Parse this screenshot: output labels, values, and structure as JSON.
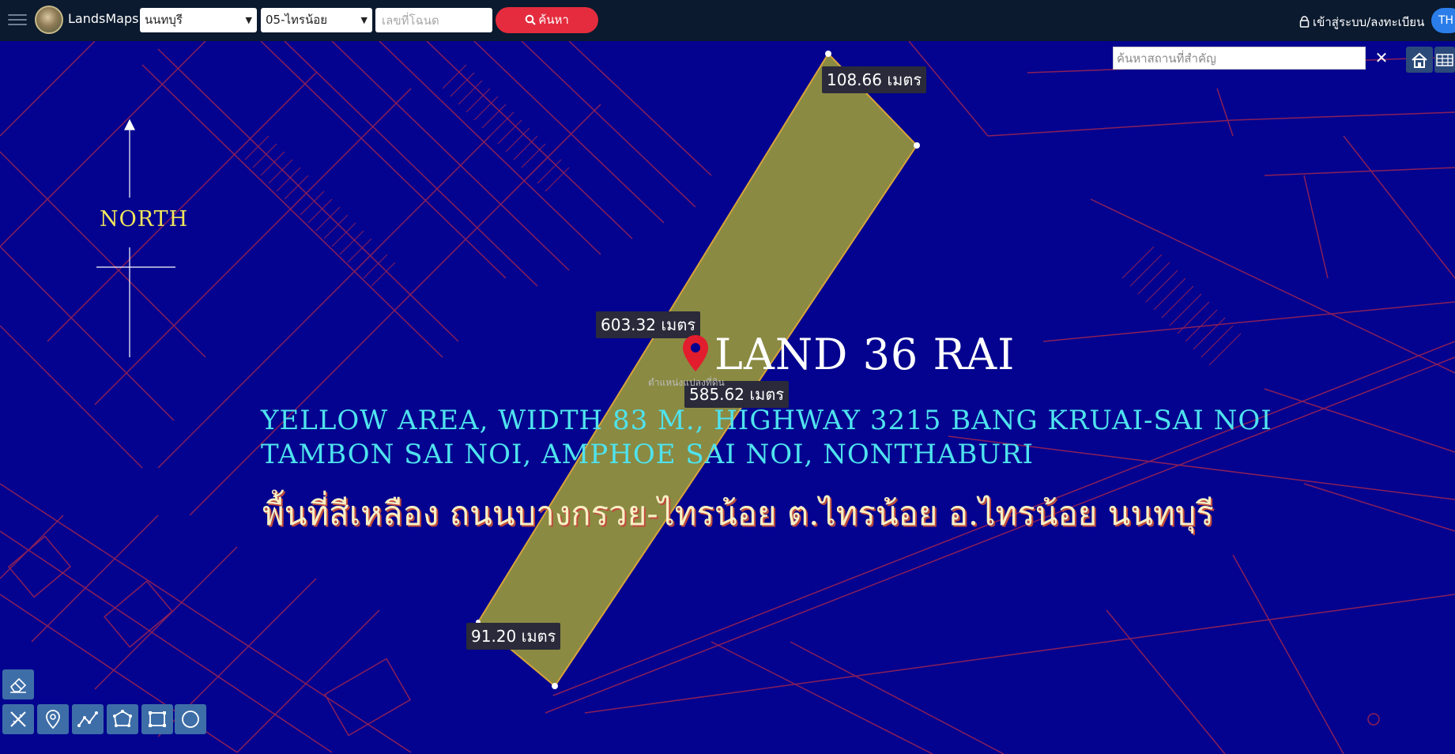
{
  "header": {
    "app_title": "LandsMaps",
    "province": "นนทบุรี",
    "district": "05-ไทรน้อย",
    "deed_placeholder": "เลขที่โฉนด",
    "search_label": "ค้นหา",
    "login_label": "เข้าสู่ระบบ/ลงทะเบียน",
    "language": "TH"
  },
  "map": {
    "place_search_placeholder": "ค้นหาสถานที่สำคัญ",
    "clear_symbol": "✕",
    "north_label": "NORTH",
    "title": "LAND 36 RAI",
    "pin_label": "ตำแหน่งแปลงที่ดิน",
    "english_line1": "YELLOW AREA, WIDTH 83 M., HIGHWAY 3215 BANG KRUAI-SAI NOI",
    "english_line2": "TAMBON SAI NOI, AMPHOE SAI NOI, NONTHABURI",
    "thai_line": "พื้นที่สีเหลือง ถนนบางกรวย-ไทรน้อย  ต.ไทรน้อย อ.ไทรน้อย นนทบุรี",
    "measurements": {
      "top": "108.66 เมตร",
      "left": "603.32 เมตร",
      "right": "585.62 เมตร",
      "bottom": "91.20 เมตร"
    }
  },
  "toolbar": {
    "tools": [
      "eraser-icon",
      "ruler-icon",
      "marker-icon",
      "polyline-icon",
      "polygon-icon",
      "rectangle-icon",
      "circle-icon"
    ]
  },
  "colors": {
    "map_background": "#03038f",
    "parcel_lines": "#8a1f5a",
    "highlight_fill": "#8a8a43",
    "search_button": "#e42c3e",
    "pin": "#e21d2d",
    "english_text": "#4fe3ee",
    "north_text": "#f2e65a"
  }
}
